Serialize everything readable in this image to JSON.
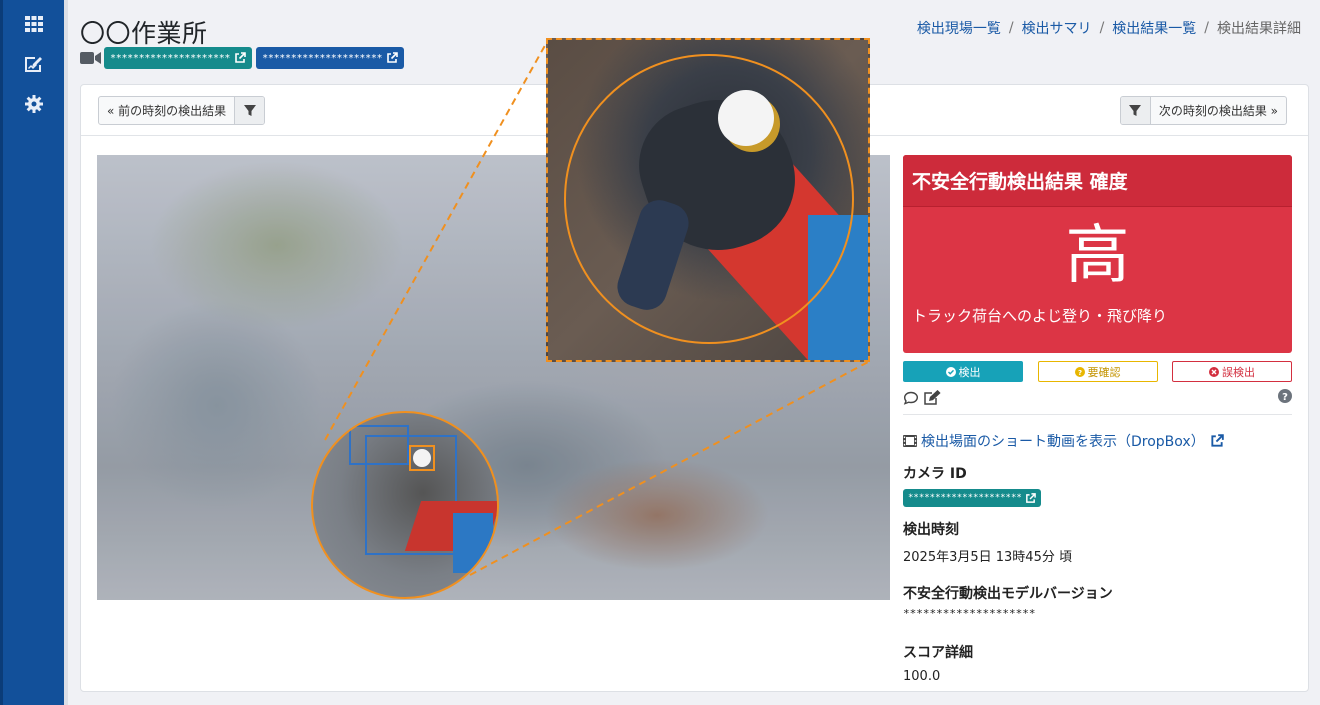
{
  "sidebar": {
    "items": [
      {
        "name": "grid-icon"
      },
      {
        "name": "edit-report-icon"
      },
      {
        "name": "gear-icon"
      }
    ]
  },
  "header": {
    "site_title": "〇〇作業所",
    "camera_links": [
      {
        "label": "*********************",
        "color": "#158b8c"
      },
      {
        "label": "*********************",
        "color": "#1a5aa6"
      }
    ]
  },
  "breadcrumb": {
    "items": [
      "検出現場一覧",
      "検出サマリ",
      "検出結果一覧"
    ],
    "current": "検出結果詳細"
  },
  "nav": {
    "prev_label": "« 前の時刻の検出結果",
    "next_label": "次の時刻の検出結果 »"
  },
  "result": {
    "title": "不安全行動検出結果 確度",
    "level": "高",
    "action": "トラック荷台へのよじ登り・飛び降り",
    "accent_color": "#dc3545"
  },
  "verdicts": {
    "detected": "検出",
    "needs_review": "要確認",
    "false_detection": "誤検出"
  },
  "details": {
    "video_link": "検出場面のショート動画を表示（DropBox）",
    "camera_id_label": "カメラ ID",
    "camera_id_value": "*********************",
    "time_label": "検出時刻",
    "time_value": "2025年3月5日 13時45分 頃",
    "model_label": "不安全行動検出モデルバージョン",
    "model_value": "********************",
    "score_label": "スコア詳細",
    "score_value": "100.0"
  }
}
